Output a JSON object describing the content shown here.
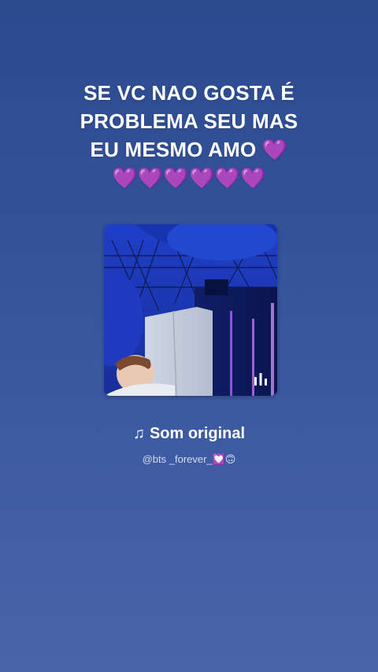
{
  "caption": {
    "line1": "SE VC NAO GOSTA É",
    "line2": "PROBLEMA SEU MAS",
    "line3_text": "EU MESMO AMO ",
    "line3_heart": "💜",
    "line4": "💜💜💜💜💜💜"
  },
  "sound": {
    "note_symbol": "♫",
    "title": "Som original",
    "author": "@bts _forever_💟🙃"
  },
  "colors": {
    "background_top": "#2b4a8e",
    "background_bottom": "#4a64a8",
    "heart": "#8a2be2"
  },
  "icons": {
    "cover_overlay": "audio-bars-icon",
    "title_prefix": "music-note-icon"
  }
}
